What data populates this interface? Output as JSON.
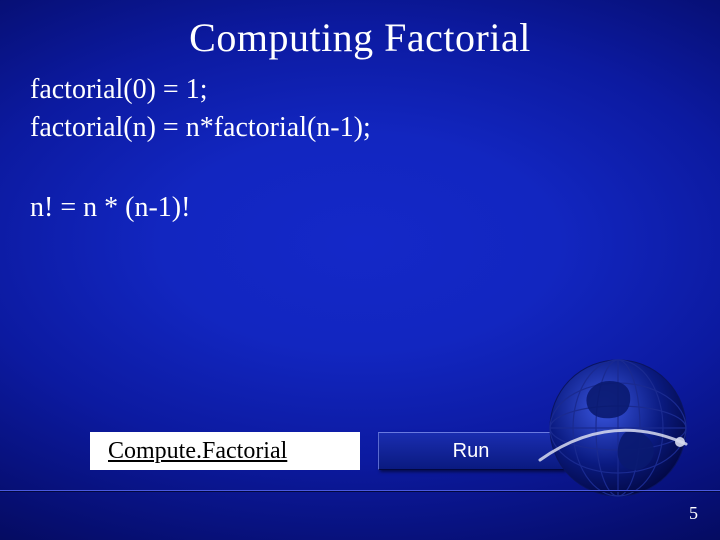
{
  "title": "Computing Factorial",
  "lines": {
    "l1": "factorial(0) = 1;",
    "l2": "factorial(n) = n*factorial(n-1);",
    "l3": "n! = n * (n-1)!"
  },
  "link_label": "Compute.Factorial",
  "run_label": "Run",
  "page_number": "5"
}
